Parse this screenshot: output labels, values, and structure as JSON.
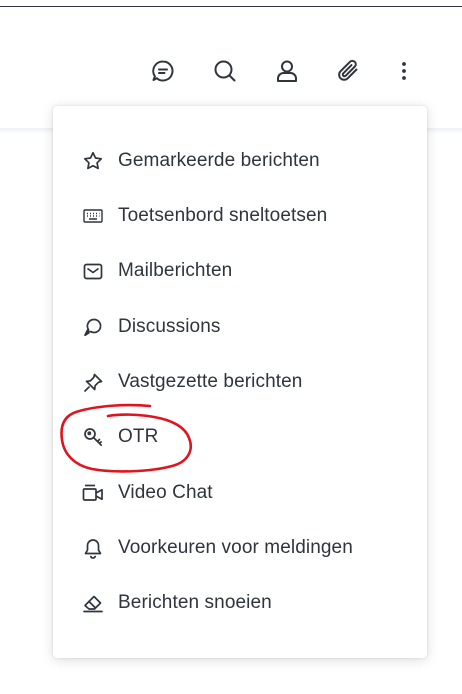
{
  "toolbar": {
    "icons": [
      "discussion-icon",
      "search-icon",
      "user-icon",
      "attachment-icon",
      "kebab-icon"
    ]
  },
  "menu": {
    "items": [
      {
        "label": "Gemarkeerde berichten",
        "icon": "star-icon"
      },
      {
        "label": "Toetsenbord sneltoetsen",
        "icon": "keyboard-icon"
      },
      {
        "label": "Mailberichten",
        "icon": "mail-icon"
      },
      {
        "label": "Discussions",
        "icon": "discussion-icon"
      },
      {
        "label": "Vastgezette berichten",
        "icon": "pin-icon"
      },
      {
        "label": "OTR",
        "icon": "key-icon"
      },
      {
        "label": "Video Chat",
        "icon": "video-icon"
      },
      {
        "label": "Voorkeuren voor meldingen",
        "icon": "bell-icon"
      },
      {
        "label": "Berichten snoeien",
        "icon": "eraser-icon"
      }
    ]
  },
  "annotation": {
    "color": "#e0141e",
    "target": "OTR"
  },
  "colors": {
    "text": "#2f343d",
    "background": "#ffffff"
  }
}
